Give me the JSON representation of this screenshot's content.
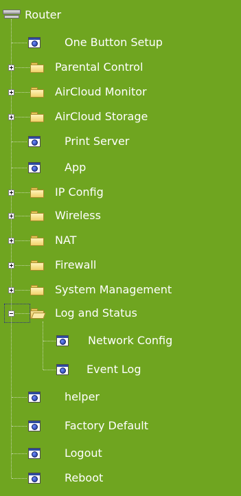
{
  "tree": {
    "root_label": "Router",
    "items": [
      {
        "label": "One Button Setup",
        "type": "page"
      },
      {
        "label": "Parental Control",
        "type": "folder",
        "state": "collapsed"
      },
      {
        "label": "AirCloud Monitor",
        "type": "folder",
        "state": "collapsed"
      },
      {
        "label": "AirCloud Storage",
        "type": "folder",
        "state": "collapsed"
      },
      {
        "label": "Print Server",
        "type": "page"
      },
      {
        "label": "App",
        "type": "page"
      },
      {
        "label": "IP Config",
        "type": "folder",
        "state": "collapsed"
      },
      {
        "label": "Wireless",
        "type": "folder",
        "state": "collapsed"
      },
      {
        "label": "NAT",
        "type": "folder",
        "state": "collapsed"
      },
      {
        "label": "Firewall",
        "type": "folder",
        "state": "collapsed"
      },
      {
        "label": "System Management",
        "type": "folder",
        "state": "collapsed"
      },
      {
        "label": "Log and Status",
        "type": "folder",
        "state": "expanded",
        "children": [
          {
            "label": "Network Config",
            "type": "page"
          },
          {
            "label": "Event Log",
            "type": "page"
          }
        ]
      },
      {
        "label": "helper",
        "type": "page"
      },
      {
        "label": "Factory Default",
        "type": "page"
      },
      {
        "label": "Logout",
        "type": "page"
      },
      {
        "label": "Reboot",
        "type": "page"
      }
    ]
  },
  "colors": {
    "background": "#6fa520",
    "text": "#ffffff"
  },
  "icons": [
    "computer-icon",
    "folder-icon",
    "folder-open-icon",
    "page-globe-icon",
    "expand-icon",
    "collapse-icon"
  ]
}
